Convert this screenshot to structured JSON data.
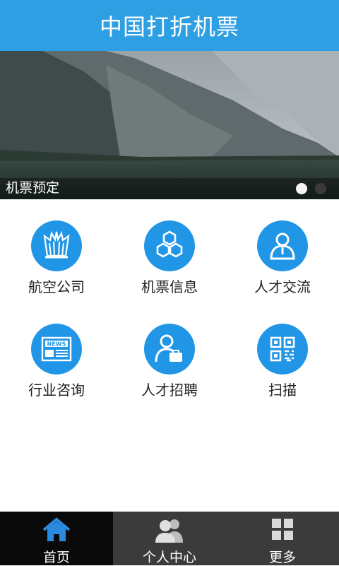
{
  "header": {
    "title": "中国打折机票"
  },
  "banner": {
    "caption": "机票预定",
    "slides": 2,
    "active_slide": 1
  },
  "grid": {
    "items": [
      {
        "label": "航空公司",
        "icon": "airline-icon"
      },
      {
        "label": "机票信息",
        "icon": "hexagon-icon"
      },
      {
        "label": "人才交流",
        "icon": "person-icon"
      },
      {
        "label": "行业咨询",
        "icon": "news-icon"
      },
      {
        "label": "人才招聘",
        "icon": "recruit-icon"
      },
      {
        "label": "扫描",
        "icon": "qr-code-icon"
      }
    ]
  },
  "tabbar": {
    "active": "home",
    "items": [
      {
        "label": "首页",
        "icon": "home-icon"
      },
      {
        "label": "个人中心",
        "icon": "users-icon"
      },
      {
        "label": "更多",
        "icon": "grid-icon"
      }
    ]
  },
  "colors": {
    "header": "#2f9fe4",
    "icon_circle": "#2196e6",
    "tab_active_icon": "#2a8ae0"
  }
}
